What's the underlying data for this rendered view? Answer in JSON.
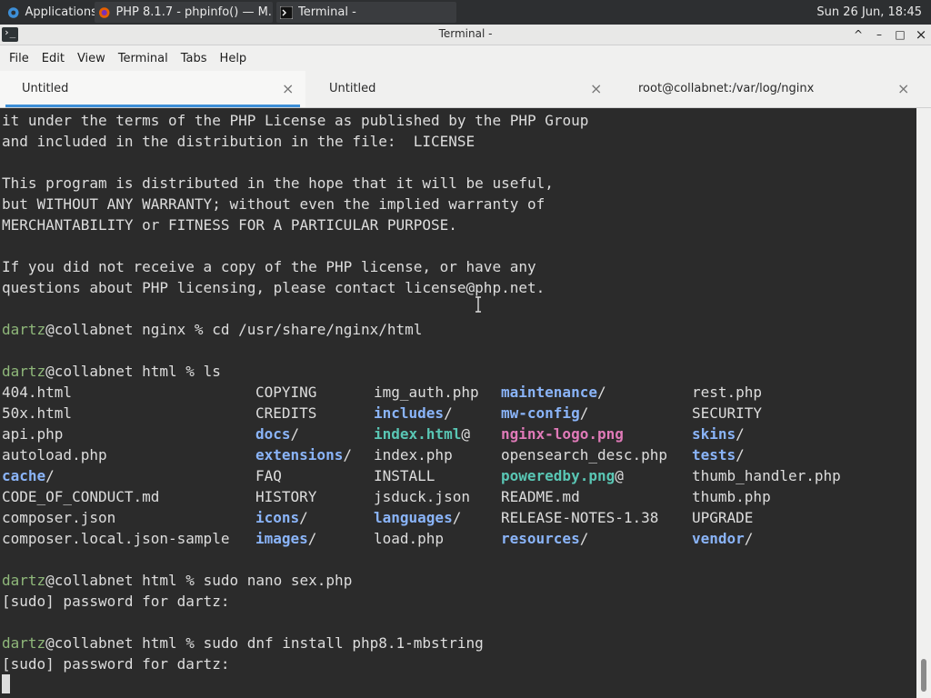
{
  "panel": {
    "apps_label": "Applications",
    "task1": "PHP 8.1.7 - phpinfo() — M...",
    "task2": "Terminal -",
    "clock": "Sun 26 Jun, 18:45"
  },
  "window": {
    "title": "Terminal -",
    "minimize": "–",
    "maximize": "□",
    "close": "×",
    "restore": "^"
  },
  "menu": [
    "File",
    "Edit",
    "View",
    "Terminal",
    "Tabs",
    "Help"
  ],
  "tabs": [
    {
      "label": "Untitled",
      "close": "×"
    },
    {
      "label": "Untitled",
      "close": "×"
    },
    {
      "label": "root@collabnet:/var/log/nginx",
      "close": "×"
    }
  ],
  "terminal": {
    "text_lines": [
      "it under the terms of the PHP License as published by the PHP Group",
      "and included in the distribution in the file:  LICENSE",
      "",
      "This program is distributed in the hope that it will be useful,",
      "but WITHOUT ANY WARRANTY; without even the implied warranty of",
      "MERCHANTABILITY or FITNESS FOR A PARTICULAR PURPOSE.",
      "",
      "If you did not receive a copy of the PHP license, or have any",
      "questions about PHP licensing, please contact license@php.net."
    ],
    "prompt_user": "dartz",
    "cmd1_host": "@collabnet nginx % ",
    "cmd1": "cd /usr/share/nginx/html",
    "cmd2_host": "@collabnet html % ",
    "cmd2": "ls",
    "ls_rows": [
      [
        {
          "t": "404.html",
          "k": ""
        },
        {
          "t": "COPYING",
          "k": ""
        },
        {
          "t": "img_auth.php",
          "k": ""
        },
        {
          "t": "maintenance",
          "k": "dir",
          "s": "/"
        },
        {
          "t": "rest.php",
          "k": ""
        }
      ],
      [
        {
          "t": "50x.html",
          "k": ""
        },
        {
          "t": "CREDITS",
          "k": ""
        },
        {
          "t": "includes",
          "k": "dir",
          "s": "/"
        },
        {
          "t": "mw-config",
          "k": "dir",
          "s": "/"
        },
        {
          "t": "SECURITY",
          "k": ""
        }
      ],
      [
        {
          "t": "api.php",
          "k": ""
        },
        {
          "t": "docs",
          "k": "dir",
          "s": "/"
        },
        {
          "t": "index.html",
          "k": "link",
          "s": "@"
        },
        {
          "t": "nginx-logo.png",
          "k": "img",
          "s": ""
        },
        {
          "t": "skins",
          "k": "dir",
          "s": "/"
        }
      ],
      [
        {
          "t": "autoload.php",
          "k": ""
        },
        {
          "t": "extensions",
          "k": "dir",
          "s": "/"
        },
        {
          "t": "index.php",
          "k": ""
        },
        {
          "t": "opensearch_desc.php",
          "k": ""
        },
        {
          "t": "tests",
          "k": "dir",
          "s": "/"
        }
      ],
      [
        {
          "t": "cache",
          "k": "dir",
          "s": "/"
        },
        {
          "t": "FAQ",
          "k": ""
        },
        {
          "t": "INSTALL",
          "k": ""
        },
        {
          "t": "poweredby.png",
          "k": "link",
          "s": "@"
        },
        {
          "t": "thumb_handler.php",
          "k": ""
        }
      ],
      [
        {
          "t": "CODE_OF_CONDUCT.md",
          "k": ""
        },
        {
          "t": "HISTORY",
          "k": ""
        },
        {
          "t": "jsduck.json",
          "k": ""
        },
        {
          "t": "README.md",
          "k": ""
        },
        {
          "t": "thumb.php",
          "k": ""
        }
      ],
      [
        {
          "t": "composer.json",
          "k": ""
        },
        {
          "t": "icons",
          "k": "dir",
          "s": "/"
        },
        {
          "t": "languages",
          "k": "dir",
          "s": "/"
        },
        {
          "t": "RELEASE-NOTES-1.38",
          "k": ""
        },
        {
          "t": "UPGRADE",
          "k": ""
        }
      ],
      [
        {
          "t": "composer.local.json-sample",
          "k": ""
        },
        {
          "t": "images",
          "k": "dir",
          "s": "/"
        },
        {
          "t": "load.php",
          "k": ""
        },
        {
          "t": "resources",
          "k": "dir",
          "s": "/"
        },
        {
          "t": "vendor",
          "k": "dir",
          "s": "/"
        }
      ]
    ],
    "cmd3_host": "@collabnet html % ",
    "cmd3": "sudo nano sex.php",
    "sudo1": "[sudo] password for dartz:",
    "cmd4_host": "@collabnet html % ",
    "cmd4": "sudo dnf install php8.1-mbstring",
    "sudo2": "[sudo] password for dartz:"
  },
  "colors": {
    "prompt": "#8fb87a",
    "directory": "#8ab4f8",
    "image": "#e07ab8",
    "symlink": "#59c6b4"
  }
}
